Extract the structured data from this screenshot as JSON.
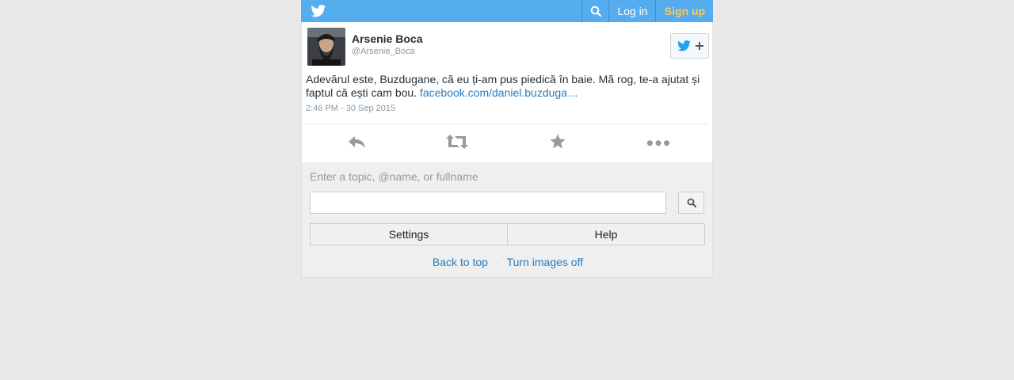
{
  "header": {
    "logo_icon": "twitter-bird-icon",
    "search_icon": "search-icon",
    "login_label": "Log in",
    "signup_label": "Sign up",
    "bar_color": "#55acee",
    "signup_color": "#ffcc4d"
  },
  "tweet": {
    "display_name": "Arsenie Boca",
    "handle": "@Arsenie_Boca",
    "text": "Adevărul este, Buzdugane, că eu ți-am pus piedică în baie. Mă rog, te-a ajutat și faptul că ești cam bou.",
    "link_text": "facebook.com/daniel.buzduga…",
    "timestamp": "2:46 PM - 30 Sep 2015",
    "follow_icon": "follow-plus-icon",
    "actions": [
      "reply-icon",
      "retweet-icon",
      "favorite-star-icon",
      "more-dots-icon"
    ],
    "link_color": "#2b7bb9"
  },
  "search": {
    "hint": "Enter a topic, @name, or fullname",
    "value": "",
    "button_icon": "search-icon"
  },
  "buttons": {
    "settings_label": "Settings",
    "help_label": "Help"
  },
  "footer": {
    "back_to_top": "Back to top",
    "separator": "·",
    "turn_images_off": "Turn images off"
  }
}
